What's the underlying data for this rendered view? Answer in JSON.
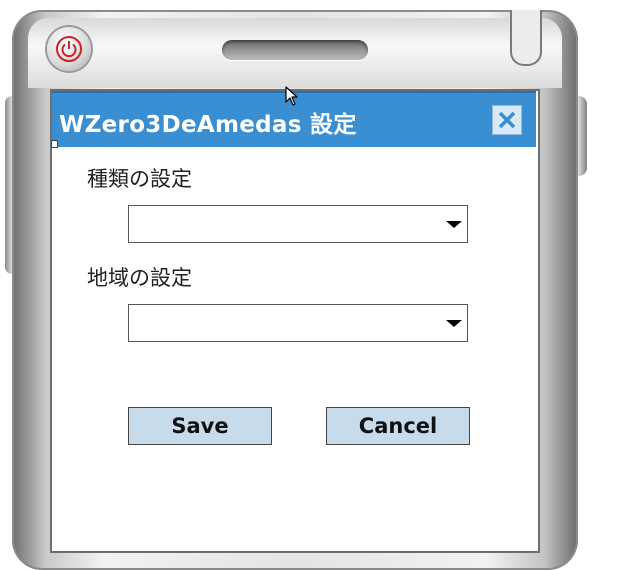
{
  "window": {
    "title": "WZero3DeAmedas 設定",
    "close_icon": "close-icon",
    "titlebar_color": "#3a8fd3"
  },
  "form": {
    "type_label": "種類の設定",
    "type_value": "",
    "region_label": "地域の設定",
    "region_value": "",
    "save_label": "Save",
    "cancel_label": "Cancel",
    "button_color": "#c8dbea"
  },
  "device": {
    "power_icon": "power-icon",
    "power_color": "#d0202a"
  }
}
